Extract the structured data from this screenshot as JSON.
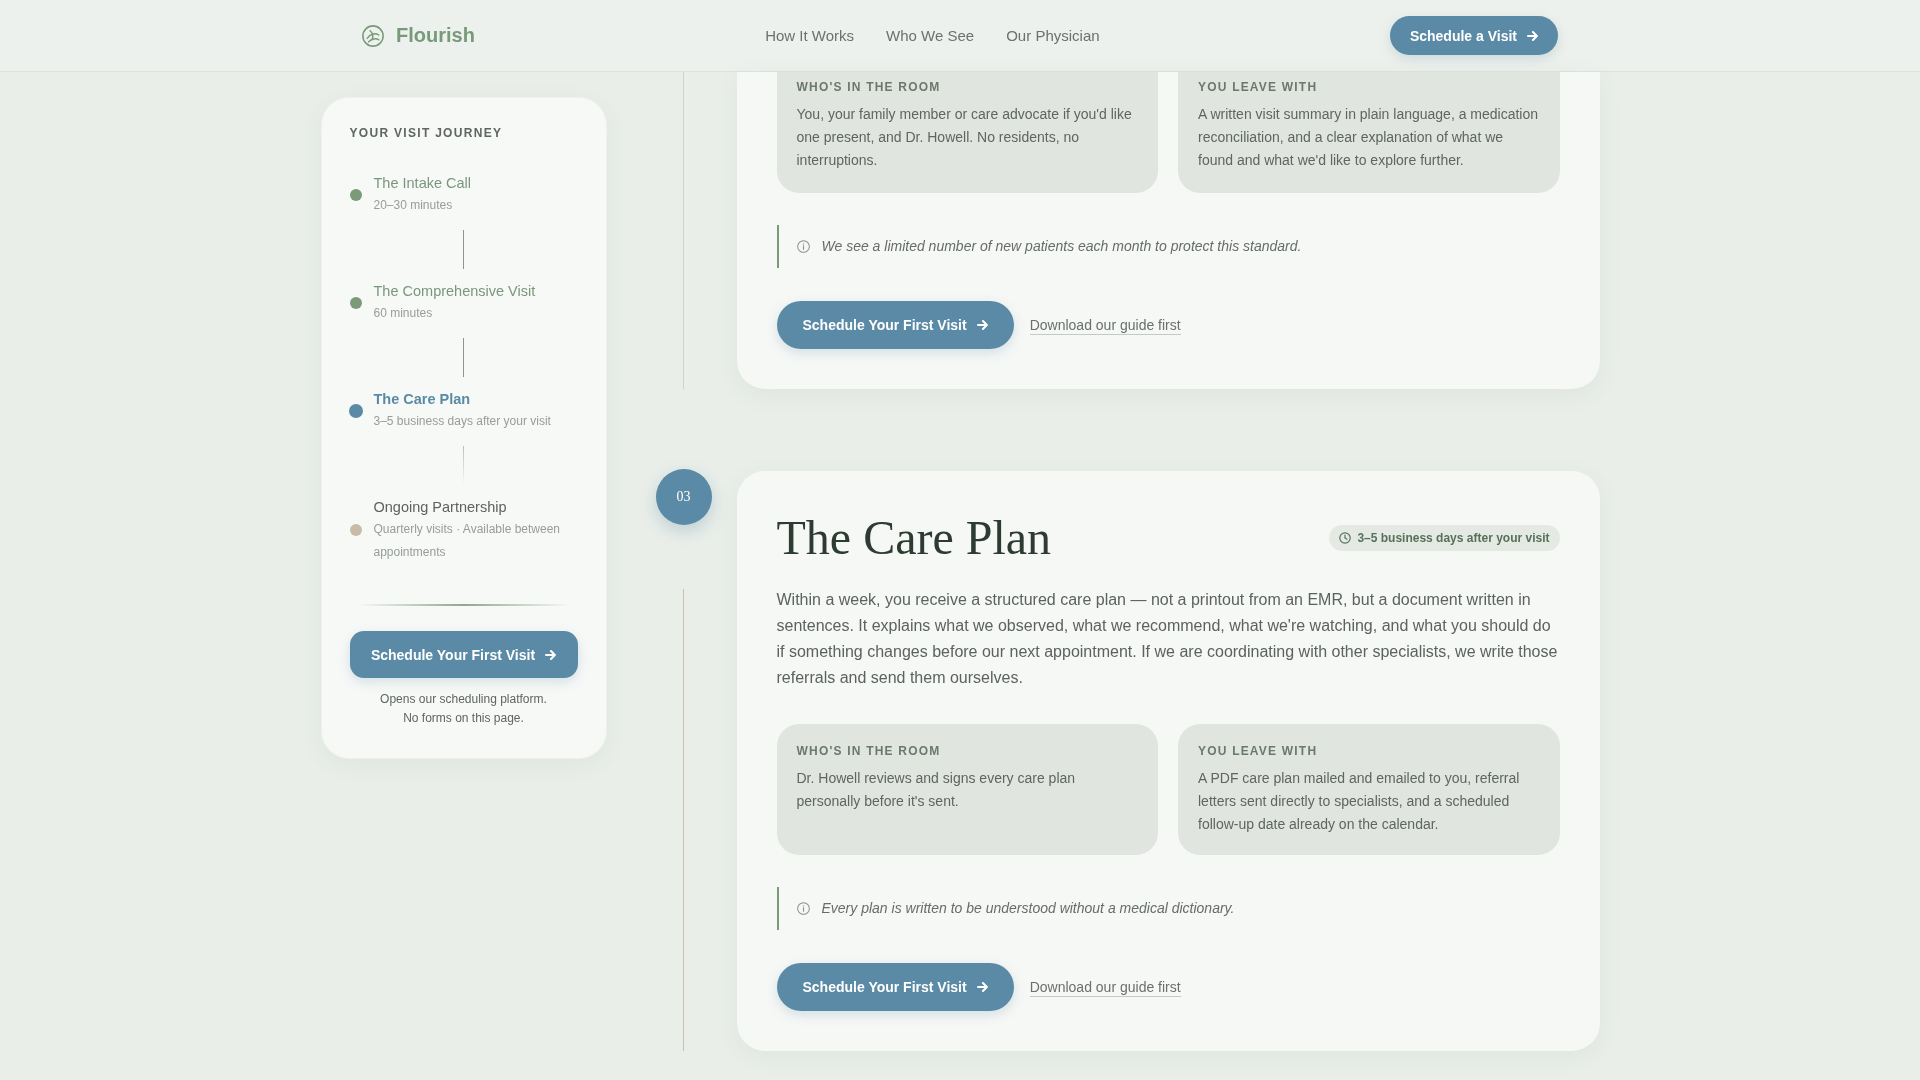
{
  "header": {
    "brand": "Flourish",
    "nav": [
      {
        "label": "How It Works"
      },
      {
        "label": "Who We See"
      },
      {
        "label": "Our Physician"
      }
    ],
    "cta": "Schedule a Visit"
  },
  "sidebar": {
    "title": "YOUR VISIT JOURNEY",
    "steps": [
      {
        "title": "The Intake Call",
        "detail": "20–30 minutes",
        "completed": true,
        "selected": false
      },
      {
        "title": "The Comprehensive Visit",
        "detail": "60 minutes",
        "completed": true,
        "selected": false
      },
      {
        "title": "The Care Plan",
        "detail": "3–5 business days after your visit",
        "completed": false,
        "selected": true
      },
      {
        "title": "Ongoing Partnership",
        "detail": "Quarterly visits · Available between appointments",
        "completed": false,
        "selected": false
      }
    ],
    "button": "Schedule Your First Visit",
    "note": [
      "Opens our scheduling platform.",
      "No forms on this page."
    ]
  },
  "sections": [
    {
      "details": [
        {
          "label": "WHO'S IN THE ROOM",
          "text": "You, your family member or care advocate if you'd like one present, and Dr. Howell. No residents, no interruptions."
        },
        {
          "label": "YOU LEAVE WITH",
          "text": "A written visit summary in plain language, a medication reconciliation, and a clear explanation of what we found and what we'd like to explore further."
        }
      ],
      "note": "We see a limited number of new patients each month to protect this standard.",
      "button": "Schedule Your First Visit",
      "link": "Download our guide first"
    },
    {
      "number": "03",
      "title": "The Care Plan",
      "badge": "3–5 business days after your visit",
      "body": "Within a week, you receive a structured care plan — not a printout from an EMR, but a document written in sentences. It explains what we observed, what we recommend, what we're watching, and what you should do if something changes before our next appointment. If we are coordinating with other specialists, we write those referrals and send them ourselves.",
      "details": [
        {
          "label": "WHO'S IN THE ROOM",
          "text": "Dr. Howell reviews and signs every care plan personally before it's sent."
        },
        {
          "label": "YOU LEAVE WITH",
          "text": "A PDF care plan mailed and emailed to you, referral letters sent directly to specialists, and a scheduled follow-up date already on the calendar."
        }
      ],
      "note": "Every plan is written to be understood without a medical dictionary.",
      "button": "Schedule Your First Visit",
      "link": "Download our guide first"
    }
  ]
}
